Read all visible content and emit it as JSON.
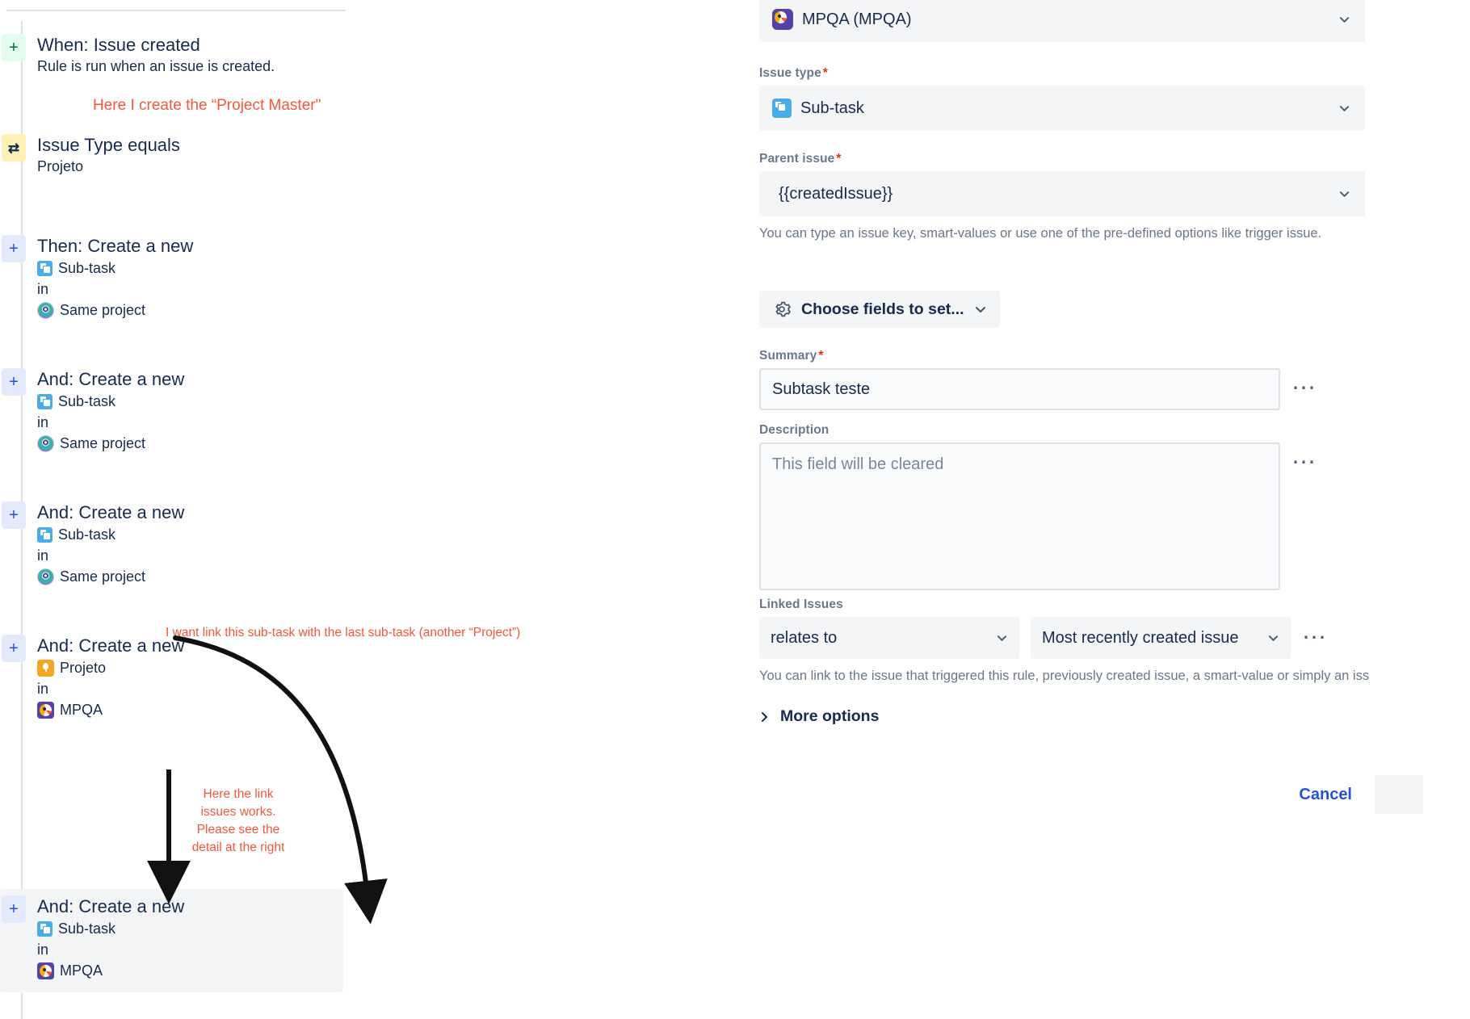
{
  "rule": {
    "steps": [
      {
        "badge": "+",
        "badge_kind": "trigger",
        "title": "When: Issue created",
        "description": "Rule is run when an issue is created.",
        "type_icon": null,
        "type_label": null,
        "in_label": null,
        "project_icon": null,
        "project_label": null
      },
      {
        "badge": "condition",
        "badge_kind": "condition",
        "title": "Issue Type equals",
        "description": "Projeto",
        "type_icon": null,
        "type_label": null,
        "in_label": null,
        "project_icon": null,
        "project_label": null
      },
      {
        "badge": "+",
        "badge_kind": "action",
        "title": "Then: Create a new",
        "description": null,
        "type_icon": "subtask-icon",
        "type_label": "Sub-task",
        "in_label": "in",
        "project_icon": "same-project-icon",
        "project_label": "Same project"
      },
      {
        "badge": "+",
        "badge_kind": "action",
        "title": "And: Create a new",
        "description": null,
        "type_icon": "subtask-icon",
        "type_label": "Sub-task",
        "in_label": "in",
        "project_icon": "same-project-icon",
        "project_label": "Same project"
      },
      {
        "badge": "+",
        "badge_kind": "action",
        "title": "And: Create a new",
        "description": null,
        "type_icon": "subtask-icon",
        "type_label": "Sub-task",
        "in_label": "in",
        "project_icon": "same-project-icon",
        "project_label": "Same project"
      },
      {
        "badge": "+",
        "badge_kind": "action",
        "title": "And: Create a new",
        "description": null,
        "type_icon": "projeto-icon",
        "type_label": "Projeto",
        "in_label": "in",
        "project_icon": "mpqa-icon",
        "project_label": "MPQA"
      },
      {
        "badge": "+",
        "badge_kind": "action",
        "title": "And: Create a new",
        "description": null,
        "type_icon": "subtask-icon",
        "type_label": "Sub-task",
        "in_label": "in",
        "project_icon": "mpqa-icon",
        "project_label": "MPQA",
        "selected": true
      }
    ]
  },
  "annotations": {
    "color": "#F4573C",
    "project_master": "Here I create the “Project Master\"",
    "link_subtask": "I want link this sub-task with the last sub-task (another “Project”)",
    "link_works": "Here the link issues works. Please see the detail at the right"
  },
  "detail": {
    "project": {
      "value": "MPQA (MPQA)",
      "icon": "mpqa-icon"
    },
    "issue_type": {
      "label": "Issue type",
      "required": true,
      "value": "Sub-task",
      "icon": "subtask-icon"
    },
    "parent_issue": {
      "label": "Parent issue",
      "required": true,
      "value": "{{createdIssue}}",
      "help": "You can type an issue key, smart-values or use one of the pre-defined options like trigger issue."
    },
    "choose_fields": {
      "label": "Choose fields to set...",
      "icon": "gear-icon"
    },
    "summary": {
      "label": "Summary",
      "required": true,
      "value": "Subtask teste"
    },
    "description": {
      "label": "Description",
      "required": false,
      "placeholder": "This field will be cleared"
    },
    "linked_issues": {
      "label": "Linked Issues",
      "link_type": "relates to",
      "target": "Most recently created issue",
      "help": "You can link to the issue that triggered this rule, previously created issue, a smart-value or simply an iss"
    },
    "more_options": {
      "label": "More options",
      "icon": "chevron-right-icon"
    },
    "footer": {
      "cancel_label": "Cancel"
    }
  },
  "colors": {
    "accent_link": "#2552d6",
    "required_star": "#DE350B",
    "annotation": "#F4573C",
    "text": "#172B4D",
    "muted": "#6B778C",
    "field_bg": "#F4F5F7"
  }
}
